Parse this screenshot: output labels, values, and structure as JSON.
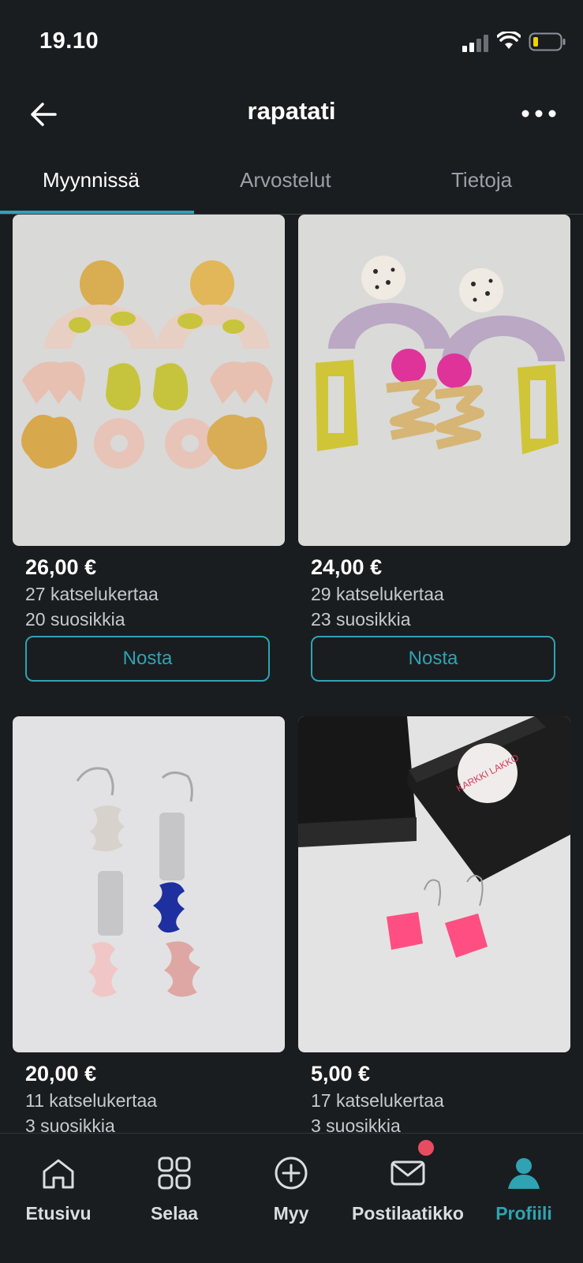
{
  "status_bar": {
    "time": "19.10"
  },
  "header": {
    "title": "rapatati"
  },
  "tabs": [
    {
      "label": "Myynnissä",
      "active": true
    },
    {
      "label": "Arvostelut",
      "active": false
    },
    {
      "label": "Tietoja",
      "active": false
    }
  ],
  "products": [
    {
      "price": "26,00 €",
      "views": "27 katselukertaa",
      "favorites": "20 suosikkia",
      "action": "Nosta"
    },
    {
      "price": "24,00 €",
      "views": "29 katselukertaa",
      "favorites": "23 suosikkia",
      "action": "Nosta"
    },
    {
      "price": "20,00 €",
      "views": "11 katselukertaa",
      "favorites": "3 suosikkia"
    },
    {
      "price": "5,00 €",
      "views": "17 katselukertaa",
      "favorites": "3 suosikkia",
      "box_label": "KARKKI LAKKO"
    }
  ],
  "bottom_nav": [
    {
      "label": "Etusivu",
      "icon": "home-icon"
    },
    {
      "label": "Selaa",
      "icon": "grid-icon"
    },
    {
      "label": "Myy",
      "icon": "plus-circle-icon"
    },
    {
      "label": "Postilaatikko",
      "icon": "mail-icon",
      "has_badge": true
    },
    {
      "label": "Profiili",
      "icon": "profile-icon",
      "active": true
    }
  ],
  "colors": {
    "accent": "#2fa3b2",
    "background": "#1a1d20",
    "badge": "#e84c5f"
  }
}
